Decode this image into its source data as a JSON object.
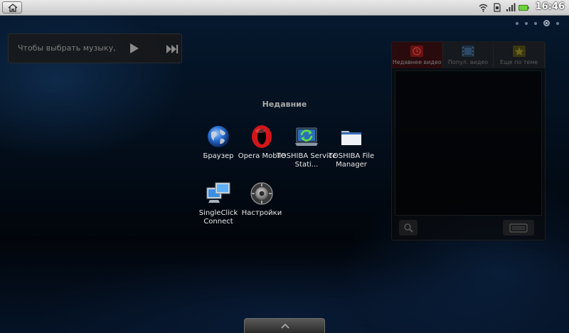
{
  "status_bar": {
    "clock": "16:46",
    "icons": [
      "wifi-icon",
      "sim-icon",
      "signal-icon",
      "battery-icon"
    ]
  },
  "home_screen": {
    "page_count": 5,
    "active_page": 4
  },
  "music_widget": {
    "text": "Чтобы выбрать музыку,"
  },
  "youtube_widget": {
    "tabs": [
      {
        "label": "Недавнее видео",
        "icon": "recent-video-icon",
        "active": true
      },
      {
        "label": "Попул. видео",
        "icon": "film-icon",
        "active": false
      },
      {
        "label": "Еще по теме",
        "icon": "star-icon",
        "active": false
      }
    ]
  },
  "recent_apps": {
    "title": "Недавние",
    "apps": [
      {
        "label": "Браузер",
        "icon": "globe-icon"
      },
      {
        "label": "Opera Mobile",
        "icon": "opera-icon"
      },
      {
        "label": "TOSHIBA Service Stati...",
        "icon": "service-station-icon"
      },
      {
        "label": "TOSHIBA File Manager",
        "icon": "folder-icon"
      },
      {
        "label": "SingleClick Connect",
        "icon": "monitors-icon"
      },
      {
        "label": "Настройки",
        "icon": "settings-icon"
      }
    ]
  },
  "colors": {
    "accent_green": "#6fd23a",
    "opera_red": "#d2151a",
    "background": "#06182e"
  }
}
